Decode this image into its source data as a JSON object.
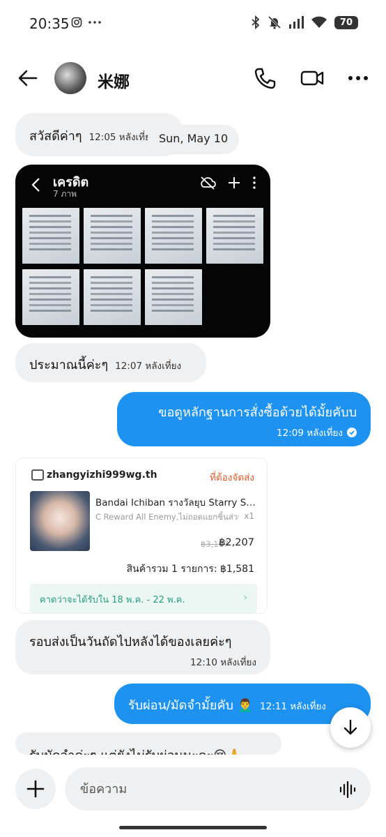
{
  "status_bar": {
    "time": "20:35",
    "left_icons": [
      "instagram-icon",
      "more-dots-icon"
    ],
    "right_icons": [
      "bluetooth-icon",
      "bell-off-icon",
      "signal-icon",
      "wifi-icon"
    ],
    "battery": "70"
  },
  "header": {
    "contact_name": "米娜"
  },
  "messages": {
    "m1": {
      "text": "สวัสดีค่าๆ",
      "time": "12:05 หลังเที่ยง"
    },
    "date_divider": "Sun, May 10",
    "image": {
      "title": "เครดิต",
      "subtitle": "7 ภาพ"
    },
    "m2": {
      "text": "ประมาณนี้ค่ะๆ",
      "time": "12:07 หลังเที่ยง"
    },
    "m3": {
      "text": "ขอดูหลักฐานการสั่งซื้อด้วยได้มั้ยคับบ",
      "time": "12:09 หลังเที่ยง"
    },
    "m4": {
      "text": "รอบส่งเป็นวันถัดไปหลังได้ของเลยค่ะๆ",
      "time": "12:10 หลังเที่ยง"
    },
    "m5": {
      "text": "รับผ่อน/มัดจำมั้ยคับ 👨‍🦱",
      "time": "12:11 หลังเที่ยง"
    },
    "m6": {
      "text": "รับมัดจำค่ะๆ แต่ยังไม่รับผ่อนนะคะ😢🙏"
    }
  },
  "order_card": {
    "shop_name": "zhangyizhi999wg.th",
    "status": "ที่ต้องจัดส่ง",
    "product_title": "Bandai Ichiban รางวัลยุบ Starry Sky ...",
    "variant": "C Reward All Enemy,ไม่ถอดแยกชิ้นส่วน",
    "qty": "x1",
    "price_old": "฿3,107",
    "price_new": "฿2,207",
    "total": "สินค้ารวม 1 รายการ: ฿1,581",
    "delivery": "คาดว่าจะได้รับใน 18 พ.ค. - 22 พ.ค."
  },
  "composer": {
    "placeholder": "ข้อความ"
  },
  "colors": {
    "outgoing_bubble": "#1d92f0",
    "incoming_bubble": "#eff0f2",
    "order_status": "#e05a2c",
    "delivery_text": "#2c9c7f"
  }
}
